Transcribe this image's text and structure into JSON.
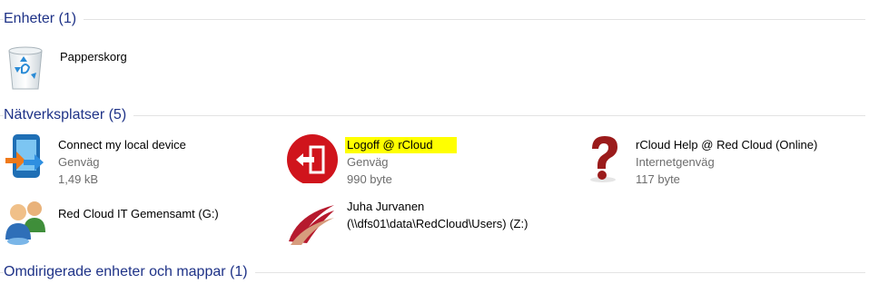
{
  "groups": {
    "devices": {
      "title": "Enheter (1)"
    },
    "network": {
      "title": "Nätverksplatser (5)"
    },
    "redirected": {
      "title": "Omdirigerade enheter och mappar (1)"
    }
  },
  "devices": [
    {
      "name": "Papperskorg",
      "icon": "recycle-bin-icon"
    }
  ],
  "network": [
    {
      "name": "Connect my local device",
      "type": "Genväg",
      "size": "1,49 kB",
      "icon": "connect-device-icon"
    },
    {
      "name": "Logoff @ rCloud",
      "type": "Genväg",
      "size": "990 byte",
      "icon": "logoff-icon",
      "highlighted": true
    },
    {
      "name": "rCloud Help @ Red Cloud (Online)",
      "type": "Internetgenväg",
      "size": "117 byte",
      "icon": "question-mark-icon"
    },
    {
      "name": "Red Cloud IT Gemensamt (G:)",
      "icon": "network-users-icon"
    },
    {
      "name": "Juha Jurvanen",
      "path": "(\\\\dfs01\\data\\RedCloud\\Users) (Z:)",
      "icon": "feather-folder-icon"
    }
  ],
  "colors": {
    "header_text": "#1e3287",
    "highlight": "#ffff00",
    "logoff_red": "#d0141c"
  }
}
